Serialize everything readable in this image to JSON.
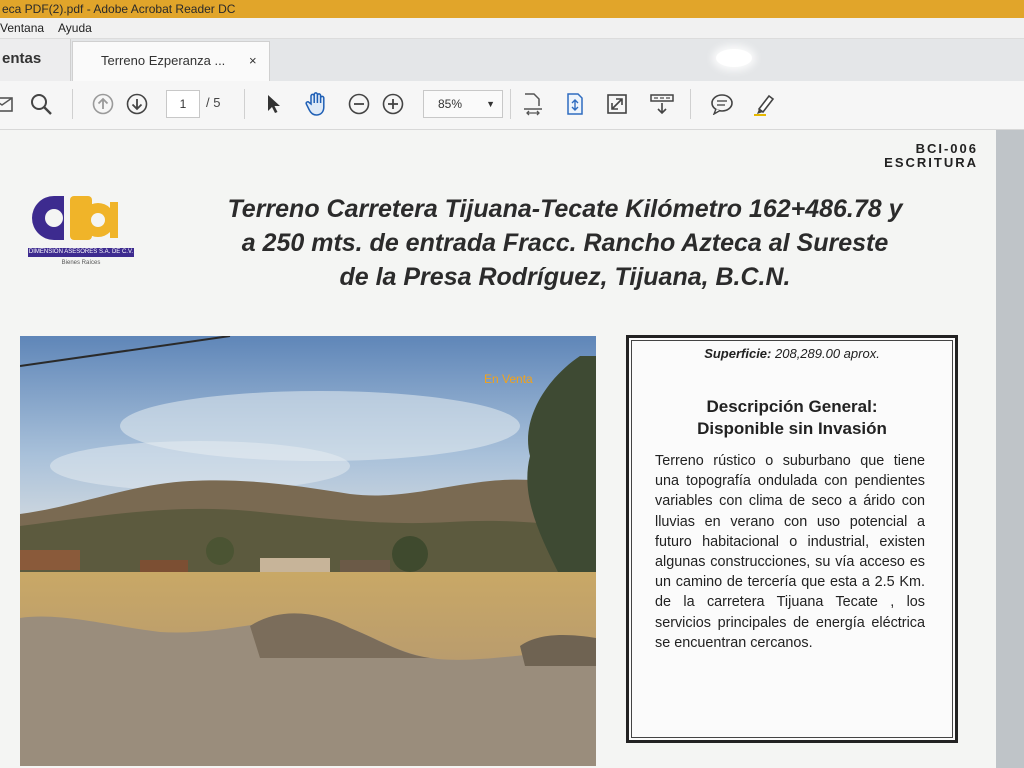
{
  "window": {
    "title": "eca PDF(2).pdf - Adobe Acrobat Reader DC"
  },
  "menu": [
    "Ventana",
    "Ayuda"
  ],
  "tabs": {
    "home_label": "entas",
    "doc_label": "Terreno Ezperanza ...",
    "close_glyph": "×"
  },
  "toolbar": {
    "page_current": "1",
    "page_total": "/ 5",
    "zoom": "85%",
    "zoom_caret": "▼"
  },
  "document": {
    "code": "BCI-006",
    "doc_type": "ESCRITURA",
    "logo": {
      "mark": "da",
      "name": "DIMENSION ASESORES S.A. DE C.V.",
      "subtitle": "Bienes Raíces",
      "colors": {
        "purple": "#3d2b8f",
        "gold": "#f0b429"
      }
    },
    "title_lines": [
      "Terreno Carretera Tijuana-Tecate Kilómetro 162+486.78 y",
      "a 250 mts. de entrada Fracc. Rancho Azteca al Sureste",
      "de la Presa Rodríguez, Tijuana, B.C.N."
    ],
    "photo_badge": "En Venta",
    "surface_label": "Superficie:",
    "surface_value": "208,289.00 aprox.",
    "desc_heading_1": "Descripción General:",
    "desc_heading_2": "Disponible sin Invasión",
    "description": "Terreno rústico o suburbano que tiene una topografía ondulada con pendientes variables con clima de seco a árido con lluvias en verano con uso potencial a futuro habitacional o industrial, existen algunas construcciones, su vía acceso es un camino de tercería que esta a 2.5 Km. de la carretera Tijuana Tecate , los servicios principales de energía eléctrica se encuentran cercanos."
  }
}
